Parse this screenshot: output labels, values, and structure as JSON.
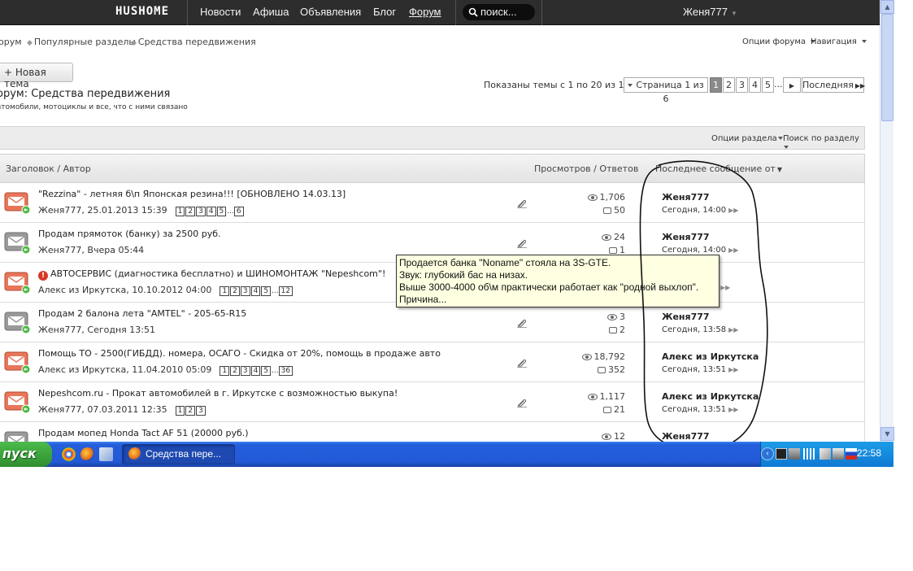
{
  "topnav": {
    "logo": "HUSHOME",
    "links": [
      "Новости",
      "Афиша",
      "Объявления",
      "Блог",
      "Форум"
    ],
    "search_placeholder": "поиск...",
    "username": "Женя777"
  },
  "breadcrumb": [
    "орум",
    "Популярные разделы",
    "Средства передвижения"
  ],
  "forum_options": "Опции форума",
  "navigation": "Навигация",
  "new_topic": "+ Новая тема",
  "forum_title": "орум: Средства передвижения",
  "forum_desc": "втомобили, мотоциклы и все, что с ними связано",
  "shown_text": "Показаны темы с 1 по 20 из 118",
  "pagination": {
    "page_of": "Страница 1 из 6",
    "pages": [
      "1",
      "2",
      "3",
      "4",
      "5"
    ],
    "ellipsis": "...",
    "last": "Последняя"
  },
  "section_options": "Опции раздела",
  "section_search": "Поиск по разделу",
  "table_header": {
    "title_author": "Заголовок / Автор",
    "views_replies": "Просмотров / Ответов",
    "last_post": "Последнее сообщение от"
  },
  "rows": [
    {
      "title": "\"Rezzina\" - летняя б\\п Японская резина!!! [ОБНОВЛЕНО 14.03.13]",
      "meta": "Женя777, 25.01.2013 15:39",
      "pages": [
        "1",
        "2",
        "3",
        "4",
        "5",
        "...",
        "6"
      ],
      "views": "1,706",
      "replies": "50",
      "last_user": "Женя777",
      "last_time": "Сегодня, 14:00",
      "hot": true,
      "clip": true
    },
    {
      "title": "Продам прямоток (банку) за 2500 руб.",
      "meta": "Женя777, Вчера 05:44",
      "pages": [],
      "views": "24",
      "replies": "1",
      "last_user": "Женя777",
      "last_time": "Сегодня, 14:00",
      "hot": false,
      "clip": true
    },
    {
      "title": "АВТОСЕРВИС (диагностика бесплатно) и ШИНОМОНТАЖ \"Nepeshcom\"!",
      "meta": "Алекс из Иркутска, 10.10.2012 04:00",
      "pages": [
        "1",
        "2",
        "3",
        "4",
        "5",
        "...",
        "12"
      ],
      "views": "",
      "replies": "",
      "last_user": "",
      "last_time": "",
      "hot": true,
      "clip": false,
      "warn": true
    },
    {
      "title": "Продам 2 балона лета \"AMTEL\" - 205-65-R15",
      "meta": "Женя777, Сегодня 13:51",
      "pages": [],
      "views": "3",
      "replies": "2",
      "last_user": "Женя777",
      "last_time": "Сегодня, 13:58",
      "hot": false,
      "clip": true
    },
    {
      "title": "Помощь ТО - 2500(ГИБДД). номера, ОСАГО - Скидка от 20%, помощь в продаже авто",
      "meta": "Алекс из Иркутска, 11.04.2010 05:09",
      "pages": [
        "1",
        "2",
        "3",
        "4",
        "5",
        "...",
        "36"
      ],
      "views": "18,792",
      "replies": "352",
      "last_user": "Алекс из Иркутска",
      "last_time": "Сегодня, 13:51",
      "hot": true,
      "clip": true
    },
    {
      "title": "Nepeshcom.ru - Прокат автомобилей в г. Иркутске с возможностью выкупа!",
      "meta": "Женя777, 07.03.2011 12:35",
      "pages": [
        "1",
        "2",
        "3"
      ],
      "views": "1,117",
      "replies": "21",
      "last_user": "Алекс из Иркутска",
      "last_time": "Сегодня, 13:51",
      "hot": true,
      "clip": true
    },
    {
      "title": "Продам мопед Honda Tact AF 51 (20000 руб.)",
      "meta": "",
      "pages": [],
      "views": "12",
      "replies": "",
      "last_user": "Женя777",
      "last_time": "",
      "hot": false,
      "clip": false
    }
  ],
  "tooltip": [
    "Продается банка \"Noname\" стояла на 3S-GTE.",
    "Звук: глубокий бас на низах.",
    "Выше 3000-4000 об\\м практически работает как \"родной выхлоп\".",
    "Причина..."
  ],
  "taskbar": {
    "start": "пуск",
    "window_title": "Средства пере...",
    "clock": "22:58"
  },
  "colors": {
    "topbar": "#2d2d2d",
    "taskbar": "#245edb",
    "start_green": "#3da53d",
    "tooltip_bg": "#ffffe1",
    "hot_icon": "#e8765a"
  }
}
